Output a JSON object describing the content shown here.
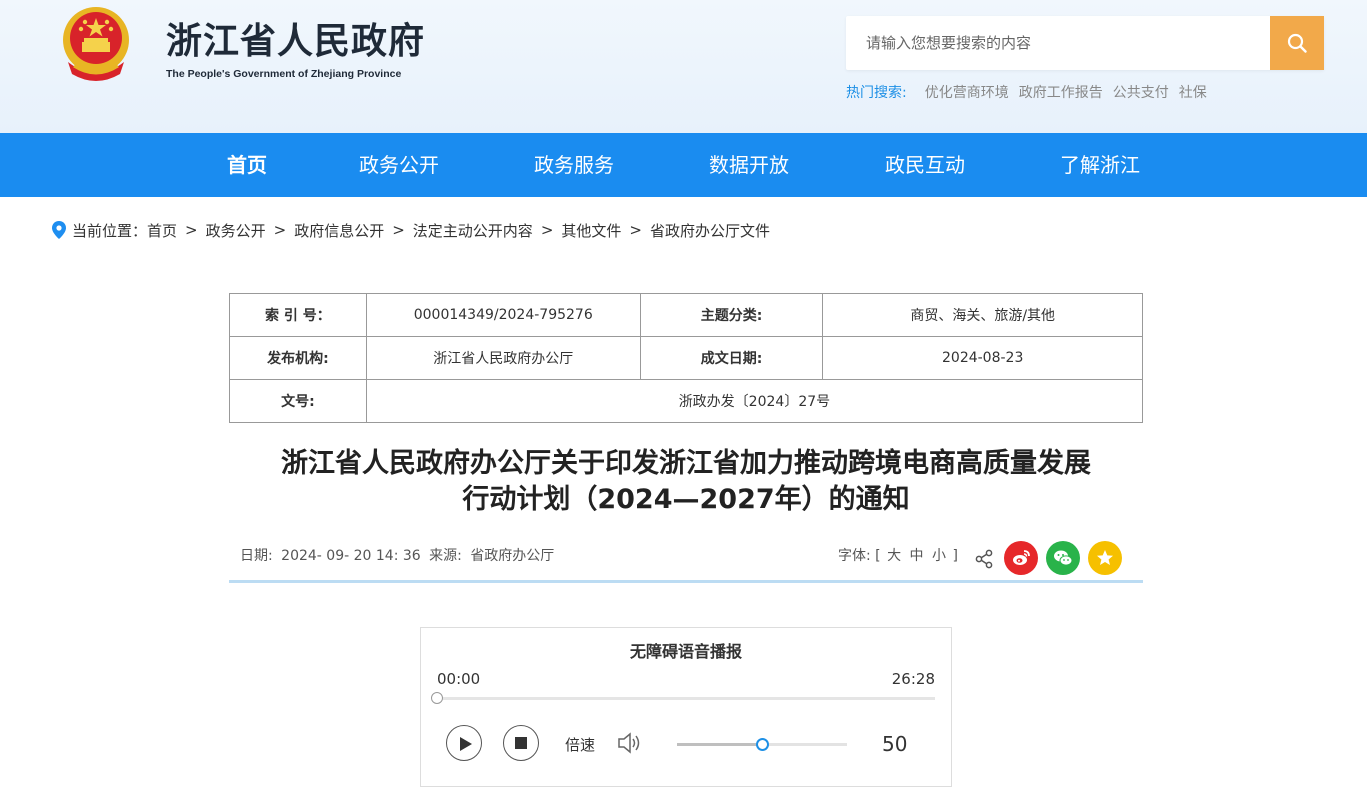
{
  "header": {
    "title": "浙江省人民政府",
    "subtitle": "The People's Government of Zhejiang Province",
    "search_placeholder": "请输入您想要搜索的内容",
    "hot_label": "热门搜索:",
    "hot_items": [
      "优化营商环境",
      "政府工作报告",
      "公共支付",
      "社保"
    ]
  },
  "nav": [
    "首页",
    "政务公开",
    "政务服务",
    "数据开放",
    "政民互动",
    "了解浙江"
  ],
  "breadcrumb": {
    "label": "当前位置：",
    "items": [
      "首页",
      "政务公开",
      "政府信息公开",
      "法定主动公开内容",
      "其他文件",
      "省政府办公厅文件"
    ],
    "separator": ">"
  },
  "meta": {
    "index_label": "索 引 号：",
    "index_value": "000014349/2024-795276",
    "topic_label": "主题分类:",
    "topic_value": "商贸、海关、旅游/其他",
    "publisher_label": "发布机构:",
    "publisher_value": "浙江省人民政府办公厅",
    "date_label": "成文日期:",
    "date_value": "2024-08-23",
    "docno_label": "文号:",
    "docno_value": "浙政办发〔2024〕27号"
  },
  "document": {
    "title_line1": "浙江省人民政府办公厅关于印发浙江省加力推动跨境电商高质量发展",
    "title_line2": "行动计划（2024—2027年）的通知",
    "date_label": "日期:",
    "date": "2024- 09- 20 14: 36",
    "source_label": "来源:",
    "source": "省政府办公厅",
    "font_label": "字体: [",
    "font_large": "大",
    "font_medium": "中",
    "font_small": "小",
    "font_close": "]"
  },
  "player": {
    "title": "无障碍语音播报",
    "current_time": "00:00",
    "total_time": "26:28",
    "progress": 0,
    "speed_label": "倍速",
    "volume": 50
  },
  "colors": {
    "nav_bg": "#1a8cf0",
    "search_btn": "#f2a94a",
    "hot_label": "#1e90e6",
    "weibo": "#e6282a",
    "wechat": "#29b34a",
    "favorite": "#f6c000"
  },
  "icons": [
    "national-emblem-icon",
    "search-icon",
    "location-pin-icon",
    "share-icon",
    "weibo-icon",
    "wechat-icon",
    "star-icon",
    "play-icon",
    "stop-icon",
    "volume-icon"
  ]
}
